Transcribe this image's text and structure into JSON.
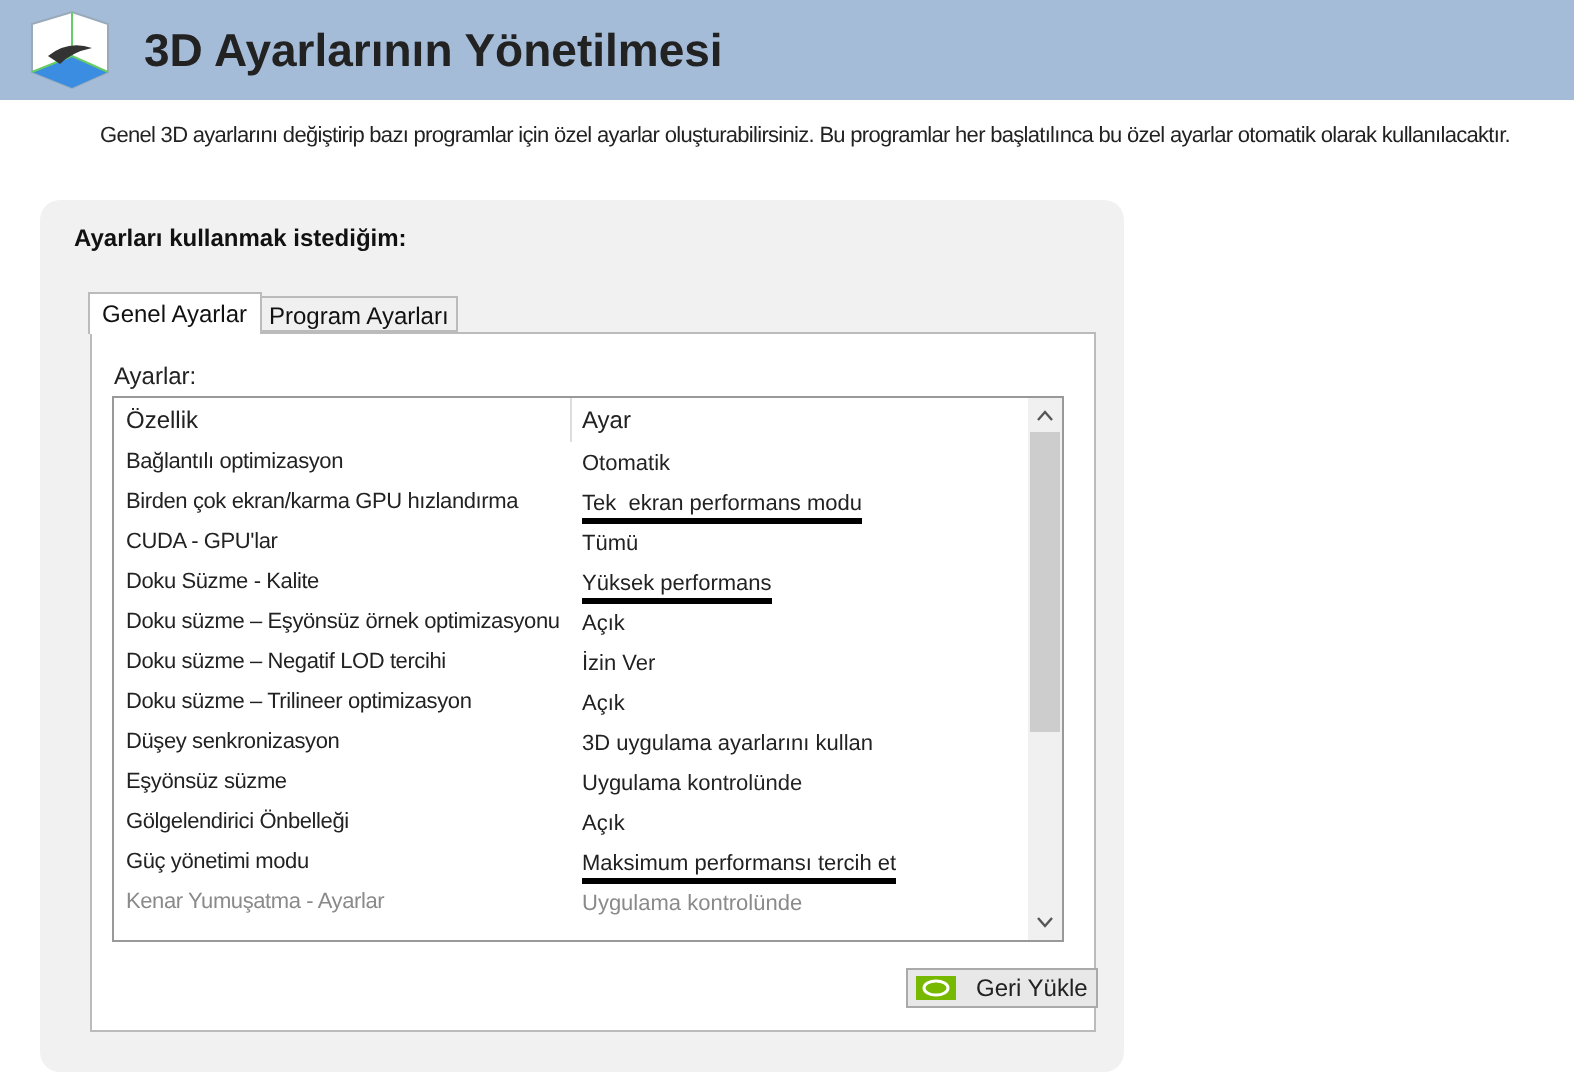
{
  "header": {
    "title": "3D Ayarlarının Yönetilmesi"
  },
  "description": "Genel 3D ayarlarını değiştirip bazı programlar için özel ayarlar oluşturabilirsiniz. Bu programlar her başlatılınca bu özel ayarlar otomatik olarak kullanılacaktır.",
  "section_title": "Ayarları kullanmak istediğim:",
  "tabs": [
    {
      "label": "Genel Ayarlar",
      "selected": true
    },
    {
      "label": "Program Ayarları",
      "selected": false
    }
  ],
  "list_label": "Ayarlar:",
  "table": {
    "columns": [
      "Özellik",
      "Ayar"
    ],
    "rows": [
      {
        "feature": "Bağlantılı optimizasyon",
        "setting": "Otomatik",
        "disabled": false,
        "underlined": false
      },
      {
        "feature": "Birden çok ekran/karma GPU hızlandırma",
        "setting": "Tek  ekran performans modu",
        "disabled": false,
        "underlined": true
      },
      {
        "feature": "CUDA - GPU'lar",
        "setting": "Tümü",
        "disabled": false,
        "underlined": false
      },
      {
        "feature": "Doku Süzme - Kalite",
        "setting": "Yüksek performans",
        "disabled": false,
        "underlined": true
      },
      {
        "feature": "Doku süzme – Eşyönsüz örnek optimizasyonu",
        "setting": "Açık",
        "disabled": false,
        "underlined": false
      },
      {
        "feature": "Doku süzme – Negatif LOD tercihi",
        "setting": "İzin Ver",
        "disabled": false,
        "underlined": false
      },
      {
        "feature": "Doku süzme – Trilineer optimizasyon",
        "setting": "Açık",
        "disabled": false,
        "underlined": false
      },
      {
        "feature": "Düşey senkronizasyon",
        "setting": "3D uygulama ayarlarını kullan",
        "disabled": false,
        "underlined": false
      },
      {
        "feature": "Eşyönsüz süzme",
        "setting": "Uygulama kontrolünde",
        "disabled": false,
        "underlined": false
      },
      {
        "feature": "Gölgelendirici Önbelleği",
        "setting": "Açık",
        "disabled": false,
        "underlined": false
      },
      {
        "feature": "Güç yönetimi modu",
        "setting": "Maksimum performansı tercih et",
        "disabled": false,
        "underlined": true
      },
      {
        "feature": "Kenar Yumuşatma - Ayarlar",
        "setting": "Uygulama kontrolünde",
        "disabled": true,
        "underlined": false
      }
    ]
  },
  "restore_button": "Geri Yükle"
}
